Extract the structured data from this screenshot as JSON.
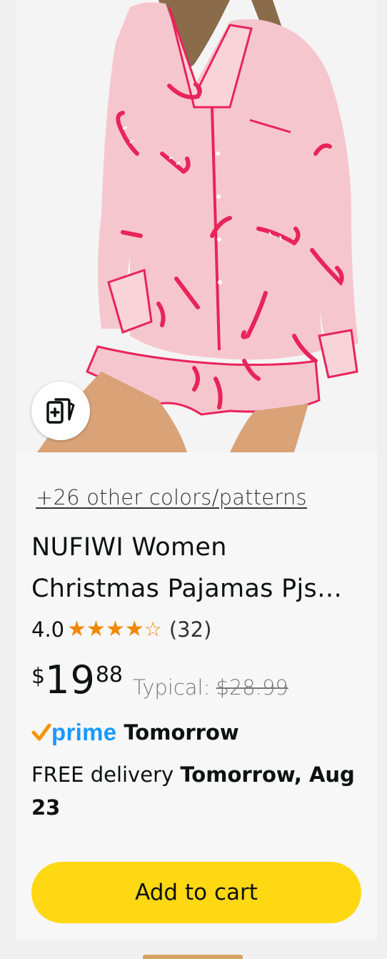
{
  "product": {
    "image_alt": "Woman wearing pink candy cane print long sleeve pajama shirt and shorts",
    "colors_link": "+26 other colors/patterns",
    "title_line1": "NUFIWI Women",
    "title_line2": "Christmas Pajamas Pjs…",
    "rating_value": "4.0",
    "rating_stars": 4,
    "rating_max": 5,
    "review_count": "(32)",
    "price_currency": "$",
    "price_whole": "19",
    "price_fraction": "88",
    "typical_label": "Typical:",
    "typical_price": "$28.99",
    "prime_label": "prime",
    "prime_delivery": "Tomorrow",
    "delivery_text_prefix": "FREE delivery ",
    "delivery_date": "Tomorrow, Aug 23",
    "add_to_cart_label": "Add to cart"
  },
  "icons": {
    "compare": "add-to-compare-icon",
    "prime_check": "prime-check-icon",
    "star_full": "★",
    "star_empty": "☆"
  },
  "colors": {
    "button_yellow": "#FFD814",
    "star_orange": "#F08804",
    "prime_blue": "#1A98FF",
    "prime_check_orange": "#F79400",
    "pajama_pink": "#F6C6CF",
    "piping_red": "#E8245A"
  }
}
